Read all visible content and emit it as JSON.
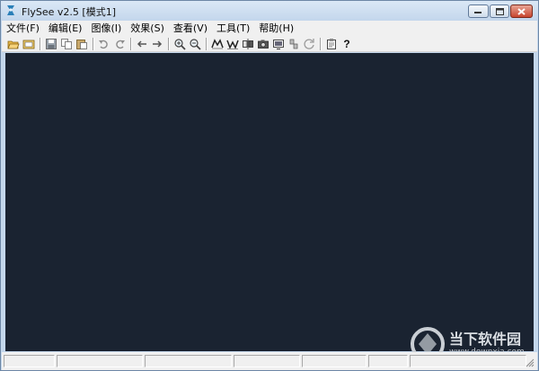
{
  "window": {
    "title": "FlySee v2.5 [模式1]"
  },
  "menubar": {
    "items": [
      {
        "id": "file",
        "label": "文件(F)"
      },
      {
        "id": "edit",
        "label": "编辑(E)"
      },
      {
        "id": "image",
        "label": "图像(I)"
      },
      {
        "id": "effect",
        "label": "效果(S)"
      },
      {
        "id": "view",
        "label": "查看(V)"
      },
      {
        "id": "tools",
        "label": "工具(T)"
      },
      {
        "id": "help",
        "label": "帮助(H)"
      }
    ]
  },
  "toolbar": {
    "buttons": [
      {
        "icon": "open-folder-icon"
      },
      {
        "icon": "open-image-icon"
      },
      {
        "icon": "save-icon"
      },
      {
        "icon": "copy-icon"
      },
      {
        "icon": "paste-icon"
      },
      {
        "icon": "undo-icon"
      },
      {
        "icon": "redo-icon"
      },
      {
        "icon": "arrow-left-icon"
      },
      {
        "icon": "arrow-right-icon"
      },
      {
        "icon": "zoom-in-icon"
      },
      {
        "icon": "zoom-out-icon"
      },
      {
        "icon": "effect-m-icon"
      },
      {
        "icon": "effect-w-icon"
      },
      {
        "icon": "mirror-icon"
      },
      {
        "icon": "camera-icon"
      },
      {
        "icon": "screen-icon"
      },
      {
        "icon": "tool-small-icon"
      },
      {
        "icon": "rotate-icon"
      },
      {
        "icon": "clipboard-icon"
      },
      {
        "icon": "help-icon",
        "label": "?"
      }
    ]
  },
  "watermark": {
    "text": "当下软件园",
    "url": "www.downxia.com"
  },
  "colors": {
    "canvas": "#1a2331",
    "titlebar": "#c3d6ec",
    "close_button": "#c7452f"
  }
}
